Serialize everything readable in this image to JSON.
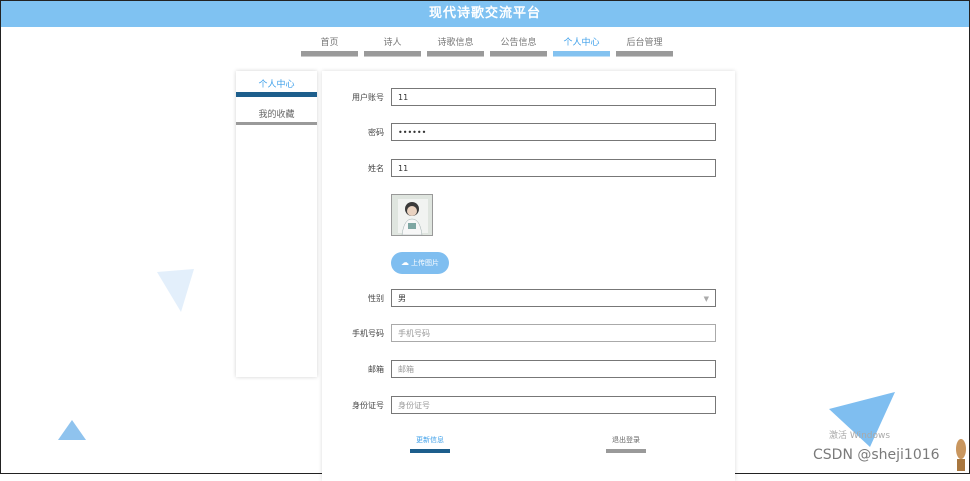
{
  "app": {
    "title": "现代诗歌交流平台"
  },
  "nav": {
    "tabs": [
      {
        "label": "首页",
        "active": false
      },
      {
        "label": "诗人",
        "active": false
      },
      {
        "label": "诗歌信息",
        "active": false
      },
      {
        "label": "公告信息",
        "active": false
      },
      {
        "label": "个人中心",
        "active": true
      },
      {
        "label": "后台管理",
        "active": false
      }
    ]
  },
  "sidebar": {
    "items": [
      {
        "label": "个人中心",
        "active": true
      },
      {
        "label": "我的收藏",
        "active": false
      }
    ]
  },
  "form": {
    "username": {
      "label": "用户账号",
      "value": "11"
    },
    "password": {
      "label": "密码",
      "value": "••••••"
    },
    "name": {
      "label": "姓名",
      "value": "11"
    },
    "upload_label": "上传图片",
    "gender": {
      "label": "性别",
      "value": "男"
    },
    "phone": {
      "label": "手机号码",
      "placeholder": "手机号码"
    },
    "email": {
      "label": "邮箱",
      "placeholder": "邮箱"
    },
    "id_card": {
      "label": "身份证号",
      "placeholder": "身份证号"
    }
  },
  "actions": {
    "update_label": "更新信息",
    "logout_label": "退出登录"
  },
  "watermarks": {
    "windows": "激活 Windows",
    "csdn": "CSDN @sheji1016"
  },
  "colors": {
    "accent": "#7fc2f2",
    "active_text": "#3fa0ea",
    "dark_underline": "#1d5e8c"
  }
}
